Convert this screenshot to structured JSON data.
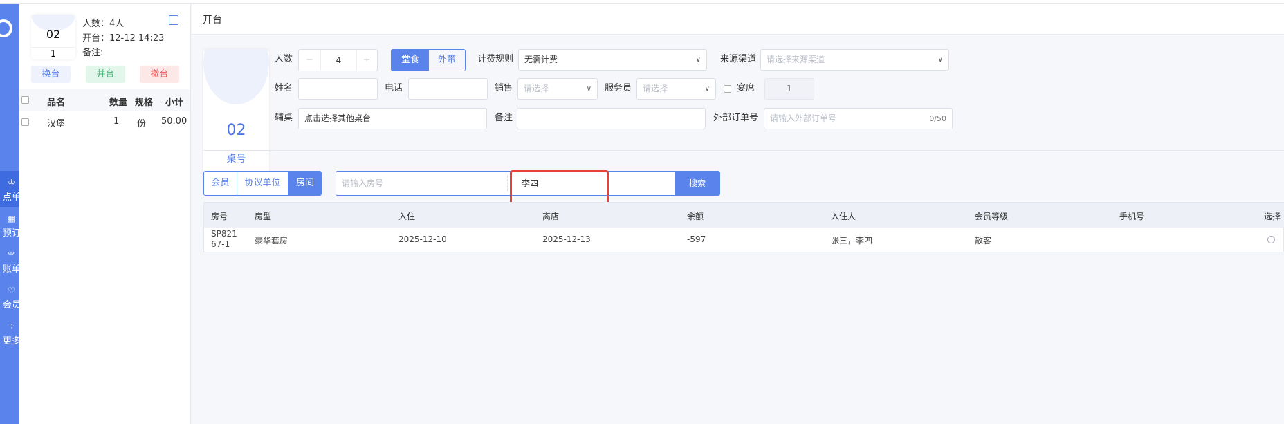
{
  "sidebar": {
    "items": [
      {
        "label": "点单",
        "icon": "chef-hat-icon",
        "active": true
      },
      {
        "label": "预订",
        "icon": "calendar-icon"
      },
      {
        "label": "账单",
        "icon": "bill-icon"
      },
      {
        "label": "会员",
        "icon": "member-icon"
      },
      {
        "label": "更多",
        "icon": "grid-icon"
      }
    ]
  },
  "left": {
    "table_no": "02",
    "seat_count": "1",
    "people": "人数：4人",
    "open_time": "开台：12-12 14:23",
    "remark": "备注:",
    "buttons": {
      "change": "换台",
      "merge": "并台",
      "cancel": "撤台"
    },
    "columns": [
      "品名",
      "数量",
      "规格",
      "小计"
    ],
    "items": [
      {
        "name": "汉堡",
        "qty": "1",
        "unit": "份",
        "subtotal": "50.00"
      }
    ]
  },
  "header": {
    "title": "开台"
  },
  "form": {
    "table_no": "02",
    "table_label": "桌号",
    "people_label": "人数",
    "people_value": "4",
    "minus": "−",
    "plus": "+",
    "dine_in": "堂食",
    "takeaway": "外带",
    "billing_label": "计费规则",
    "billing_value": "无需计费",
    "source_label": "来源渠道",
    "source_placeholder": "请选择来源渠道",
    "name_label": "姓名",
    "phone_label": "电话",
    "sales_label": "销售",
    "sales_placeholder": "请选择",
    "waiter_label": "服务员",
    "waiter_placeholder": "请选择",
    "banquet_label": "宴席",
    "banquet_value": "1",
    "aux_label": "辅桌",
    "aux_value": "点击选择其他桌台",
    "remark_label": "备注",
    "ext_label": "外部订单号",
    "ext_placeholder": "请输入外部订单号",
    "ext_count": "0/50"
  },
  "search": {
    "tabs": [
      "会员",
      "协议单位",
      "房间"
    ],
    "active_tab": 2,
    "room_placeholder": "请输入房号",
    "name_value": "李四",
    "button": "搜索"
  },
  "table": {
    "columns": [
      "房号",
      "房型",
      "入住",
      "离店",
      "余额",
      "入住人",
      "会员等级",
      "手机号",
      "选择"
    ],
    "rows": [
      {
        "room": "SP82167-1",
        "type": "豪华套房",
        "checkin": "2025-12-10",
        "checkout": "2025-12-13",
        "balance": "-597",
        "guests": "张三，李四",
        "level": "散客",
        "phone": ""
      }
    ]
  },
  "colors": {
    "primary": "#5a83ec",
    "highlight": "#e8413a"
  }
}
